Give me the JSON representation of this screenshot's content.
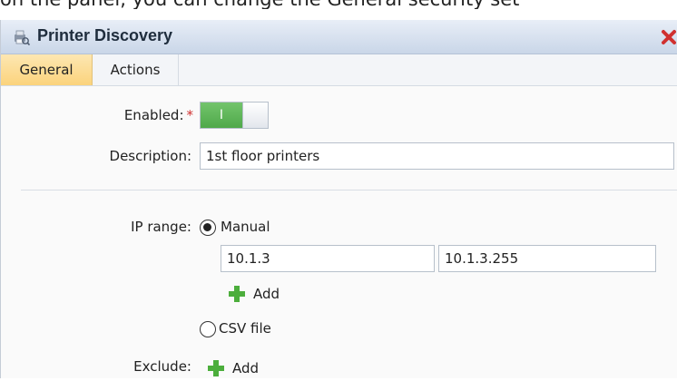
{
  "window": {
    "title": "Printer Discovery",
    "icon": "printer-discovery-icon",
    "close_icon": "close-icon"
  },
  "tabs": [
    {
      "label": "General",
      "active": true
    },
    {
      "label": "Actions",
      "active": false
    }
  ],
  "form": {
    "enabled_label": "Enabled:",
    "required_mark": "*",
    "enabled_toggle_text": "I",
    "enabled": true,
    "description_label": "Description:",
    "description_value": "1st floor printers",
    "ip_range_label": "IP range:",
    "manual_option": "Manual",
    "manual_selected": true,
    "ip_from": "10.1.3",
    "ip_to": "10.1.3.255",
    "add_label": "Add",
    "csv_option": "CSV file",
    "exclude_label": "Exclude:",
    "exclude_add_label": "Add"
  },
  "colors": {
    "toggle_on": "#4fa94a",
    "active_tab": "#fbd37c",
    "close": "#d0302f",
    "plus": "#4cae3c"
  }
}
